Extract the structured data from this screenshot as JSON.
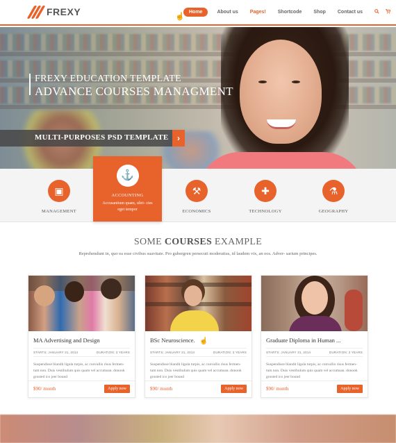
{
  "brand": {
    "name": "FREXY",
    "accent": "#e8622c"
  },
  "nav": {
    "items": [
      "Home",
      "About us",
      "Pages!",
      "Shortcode",
      "Shop",
      "Contact us"
    ],
    "search_icon": "search-icon",
    "cart_icon": "cart-icon"
  },
  "hero": {
    "subtitle": "FREXY EDUCATION TEMPLATE",
    "title": "ADVANCE COURSES MANAGMENT",
    "banner": "MULTI-PURPOSES PSD TEMPLATE",
    "arrow": "›"
  },
  "categories": {
    "items": [
      {
        "label": "MANAGEMENT",
        "icon": "briefcase-icon",
        "glyph": "▣"
      },
      {
        "label": "ECONOMICS",
        "icon": "gavel-icon",
        "glyph": "⚒"
      },
      {
        "label": "TECHNOLOGY",
        "icon": "puzzle-icon",
        "glyph": "✚"
      },
      {
        "label": "GEOGRAPHY",
        "icon": "flask-icon",
        "glyph": "⚗"
      }
    ],
    "active": {
      "label": "ACCOUNTING",
      "icon": "anchor-icon",
      "glyph": "⚓",
      "desc": "Accusantium quam, ultri- cies eget tempor"
    }
  },
  "courses": {
    "title_prefix": "SOME",
    "title_bold": "COURSES",
    "title_suffix": "EXAMPLE",
    "desc": "Reprehendunt in, quo ea esse civibus suavitate. Pro gubergren persecuti moderatius, id laudem vix, an eos. Adver- sarium principes.",
    "cards": [
      {
        "title": "MA Advertising and Design",
        "starts": "STARTS: JANUARY 31, 2014",
        "duration": "DURATION: 3 YEARS",
        "text": "Suspendisse blandit ligula turpis, ac convallis risus fermen- tum non. Duis vestibulum quis quam vel accumsan. donook grosted ico jeer bound",
        "price": "$90/ month",
        "button": "Apply now"
      },
      {
        "title": "BSc Neuroscience.",
        "starts": "STARTS: JANUARY 31, 2014",
        "duration": "DURATION: 3 YEARS",
        "text": "Suspendisse blandit ligula turpis, ac convallis risus fermen- tum non. Duis vestibulum quis quam vel accumsan. donook grosted ico jeer bound",
        "price": "$90/ month",
        "button": "Apply now"
      },
      {
        "title": "Graduate Diploma in Human ...",
        "starts": "STARTS: JANUARY 31, 2014",
        "duration": "DURATION: 3 YEARS",
        "text": "Suspendisse blandit ligula turpis, ac convallis risus fermen- tum non. Duis vestibulum quis quam vel accumsan. donook grosted ico jeer bound",
        "price": "$90/ month",
        "button": "Apply now"
      }
    ]
  }
}
